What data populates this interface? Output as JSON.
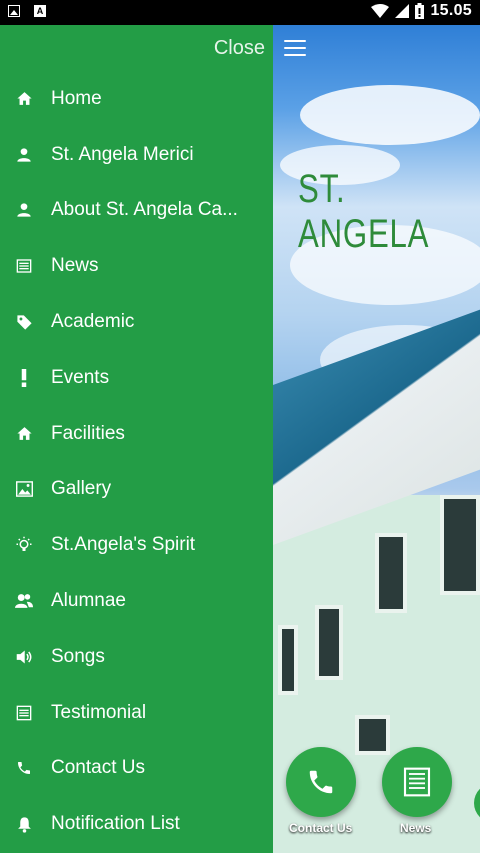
{
  "status_bar": {
    "time": "15.05",
    "icons": [
      "image-icon",
      "a-icon",
      "wifi-icon",
      "signal-icon",
      "battery-icon"
    ]
  },
  "drawer": {
    "close_label": "Close",
    "items": [
      {
        "label": "Home",
        "icon": "home-icon"
      },
      {
        "label": "St. Angela Merici",
        "icon": "person-icon"
      },
      {
        "label": "About St. Angela Ca...",
        "icon": "person-icon"
      },
      {
        "label": "News",
        "icon": "newspaper-icon"
      },
      {
        "label": "Academic",
        "icon": "tag-icon"
      },
      {
        "label": "Events",
        "icon": "exclamation-icon"
      },
      {
        "label": "Facilities",
        "icon": "home-icon"
      },
      {
        "label": "Gallery",
        "icon": "picture-icon"
      },
      {
        "label": "St.Angela's Spirit",
        "icon": "lightbulb-icon"
      },
      {
        "label": "Alumnae",
        "icon": "group-icon"
      },
      {
        "label": "Songs",
        "icon": "speaker-icon"
      },
      {
        "label": "Testimonial",
        "icon": "list-icon"
      },
      {
        "label": "Contact Us",
        "icon": "phone-icon"
      },
      {
        "label": "Notification List",
        "icon": "bell-icon"
      }
    ]
  },
  "main": {
    "brand": "ST. ANGELA",
    "fab_contact_label": "Contact Us",
    "fab_news_label": "News"
  },
  "colors": {
    "drawer": "#239d46",
    "fab": "#2ea84a",
    "brand_text": "#2e8b3a"
  }
}
